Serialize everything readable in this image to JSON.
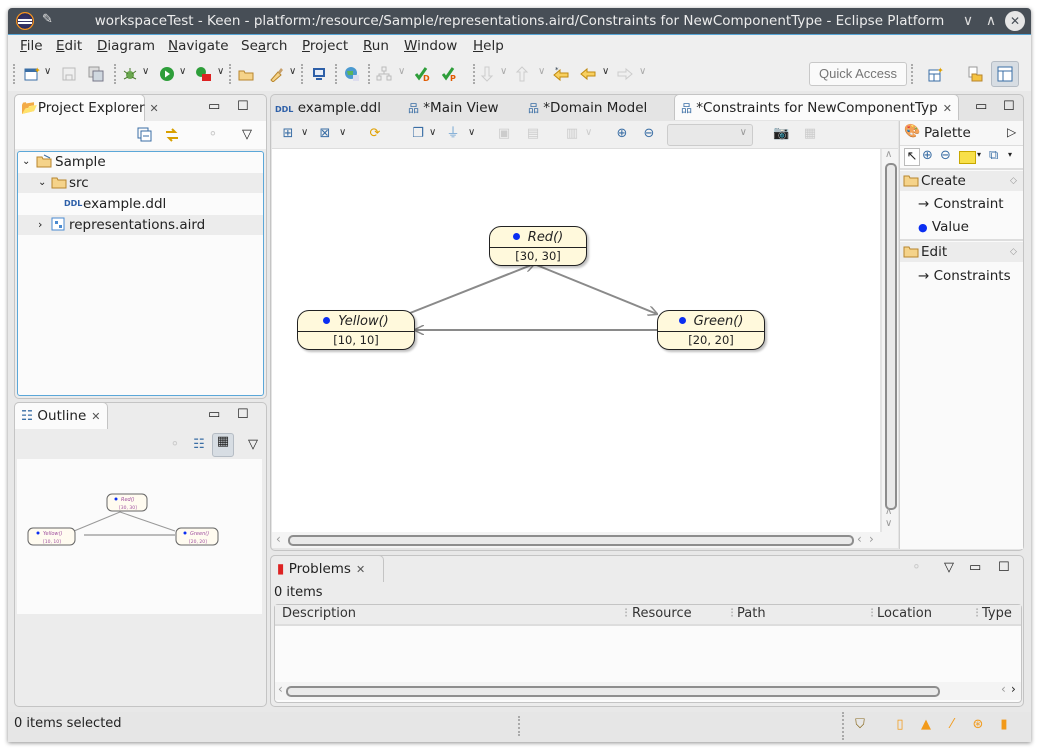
{
  "window": {
    "title": "workspaceTest - Keen - platform:/resource/Sample/representations.aird/Constraints for NewComponentType - Eclipse Platform",
    "icons": {
      "logo": "eclipse-logo-icon",
      "pin": "pin-icon",
      "minimize": "chevron-down-icon",
      "maximize": "chevron-up-icon",
      "close": "close-circle-icon"
    },
    "glyphs": {
      "pin": "✎",
      "minimize": "∨",
      "maximize": "∧",
      "close": "✕"
    }
  },
  "menu": [
    {
      "label": "File",
      "mnemonic": "F",
      "rest": "ile"
    },
    {
      "label": "Edit",
      "mnemonic": "E",
      "rest": "dit"
    },
    {
      "label": "Diagram",
      "mnemonic": "D",
      "rest": "iagram"
    },
    {
      "label": "Navigate",
      "mnemonic": "N",
      "rest": "avigate"
    },
    {
      "label": "Search",
      "pre": "Se",
      "mnemonic": "a",
      "rest": "rch"
    },
    {
      "label": "Project",
      "mnemonic": "P",
      "rest": "roject"
    },
    {
      "label": "Run",
      "mnemonic": "R",
      "rest": "un"
    },
    {
      "label": "Window",
      "mnemonic": "W",
      "rest": "indow"
    },
    {
      "label": "Help",
      "mnemonic": "H",
      "rest": "elp"
    }
  ],
  "toolbar": {
    "quick_access_placeholder": "Quick Access",
    "icons": [
      "new-icon",
      "save-icon",
      "save-all-icon",
      "debug-icon",
      "run-icon",
      "run-external-icon",
      "open-type-icon",
      "search-brush-icon",
      "console-icon",
      "globe-icon",
      "hierarchy-icon",
      "validate-d-icon",
      "validate-p-icon",
      "next-annotation-icon",
      "prev-annotation-icon",
      "last-edit-icon",
      "back-icon",
      "forward-icon",
      "open-perspective-icon",
      "resource-perspective-icon",
      "sirius-perspective-icon"
    ]
  },
  "project_explorer": {
    "title": "Project Explorer",
    "tree": [
      {
        "label": "Sample",
        "icon": "project-folder-icon",
        "expanded": true,
        "level": 0
      },
      {
        "label": "src",
        "icon": "folder-icon",
        "expanded": true,
        "level": 1
      },
      {
        "label": "example.ddl",
        "icon": "ddl-file-icon",
        "level": 2
      },
      {
        "label": "representations.aird",
        "icon": "aird-file-icon",
        "expanded": false,
        "level": 1
      }
    ],
    "tree_glyphs": {
      "expanded": "⌄",
      "collapsed": "›"
    }
  },
  "outline": {
    "title": "Outline",
    "nodes": [
      {
        "name": "Red()",
        "value": "[30, 30]"
      },
      {
        "name": "Yellow()",
        "value": "[10, 10]"
      },
      {
        "name": "Green()",
        "value": "[20, 20]"
      }
    ]
  },
  "editor": {
    "tabs": [
      {
        "label": "example.ddl",
        "icon": "ddl-file-icon",
        "active": false
      },
      {
        "label": "*Main View",
        "icon": "diagram-icon",
        "active": false
      },
      {
        "label": "*Domain Model",
        "icon": "diagram-icon",
        "active": false
      },
      {
        "label": "*Constraints for NewComponentTyp",
        "icon": "diagram-icon",
        "active": true
      }
    ],
    "zoom_select_value": "",
    "diagram": {
      "nodes": [
        {
          "id": "red",
          "name": "Red()",
          "value": "[30, 30]"
        },
        {
          "id": "yellow",
          "name": "Yellow()",
          "value": "[10, 10]"
        },
        {
          "id": "green",
          "name": "Green()",
          "value": "[20, 20]"
        }
      ],
      "edges": [
        {
          "from": "yellow",
          "to": "red"
        },
        {
          "from": "red",
          "to": "green"
        },
        {
          "from": "green",
          "to": "yellow"
        }
      ],
      "colors": {
        "node_fill": "#fff9dc",
        "dot": "#0b2ef2",
        "edge": "#8a8a8a"
      }
    }
  },
  "palette": {
    "title": "Palette",
    "groups": [
      {
        "label": "Create",
        "items": [
          {
            "label": "Constraint",
            "icon": "arrow-right-icon",
            "glyph": "→"
          },
          {
            "label": "Value",
            "icon": "blue-dot-icon",
            "glyph": "●"
          }
        ]
      },
      {
        "label": "Edit",
        "items": [
          {
            "label": "Constraints",
            "icon": "arrow-right-icon",
            "glyph": "→"
          }
        ]
      }
    ]
  },
  "problems": {
    "title": "Problems",
    "count_text": "0 items",
    "columns": [
      "Description",
      "Resource",
      "Path",
      "Location",
      "Type"
    ],
    "rows": []
  },
  "status": {
    "text": "0 items selected"
  }
}
